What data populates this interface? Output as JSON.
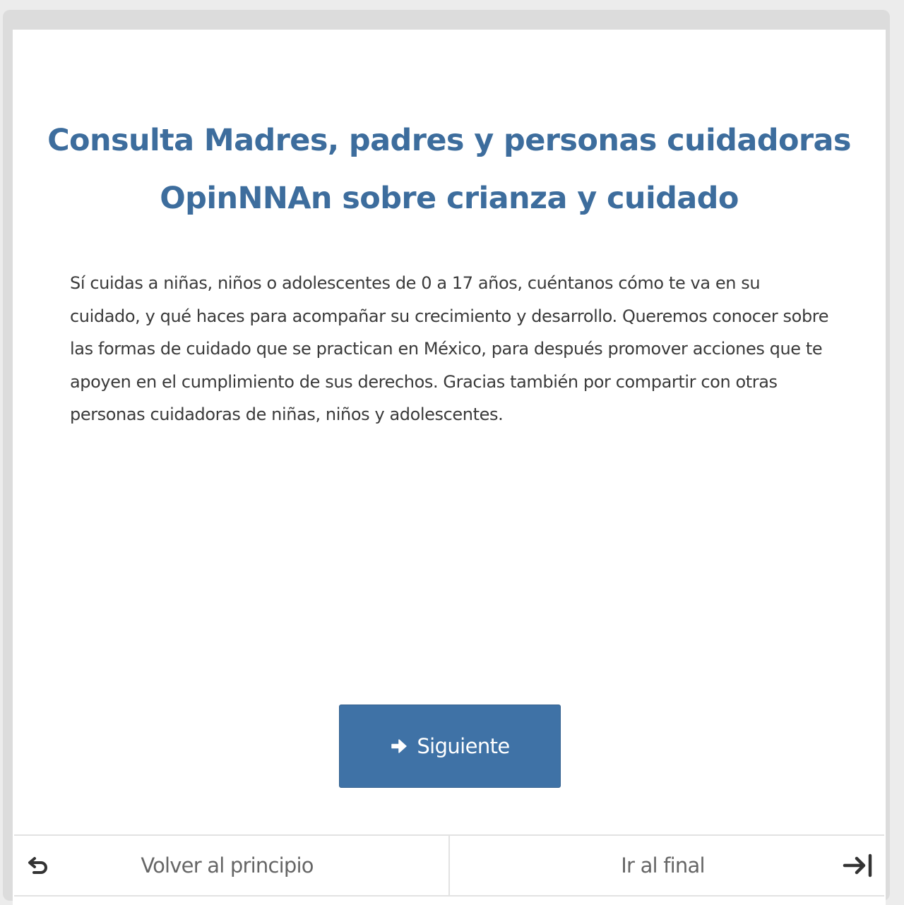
{
  "survey": {
    "title": "Consulta Madres, padres y personas cuidadoras OpinNNAn sobre crianza y cuidado",
    "description": "Sí cuidas a niñas, niños o adolescentes de 0 a 17 años, cuéntanos cómo te va en su cuidado, y qué haces para acompañar su crecimiento y desarrollo. Queremos conocer sobre las formas de cuidado que se practican en México, para después promover acciones que te apoyen en el cumplimiento de sus derechos. Gracias también por compartir con otras personas cuidadoras de niñas, niños y adolescentes."
  },
  "actions": {
    "next_label": "Siguiente",
    "next_icon": "arrow-right-icon"
  },
  "footer": {
    "back_to_start_label": "Volver al principio",
    "back_to_start_icon": "undo-arrow-icon",
    "go_to_end_label": "Ir al final",
    "go_to_end_icon": "arrow-to-end-icon"
  },
  "colors": {
    "title": "#3d6d9d",
    "button_bg": "#3f72a6",
    "body_text": "#3a3a3a",
    "footer_text": "#666666"
  }
}
